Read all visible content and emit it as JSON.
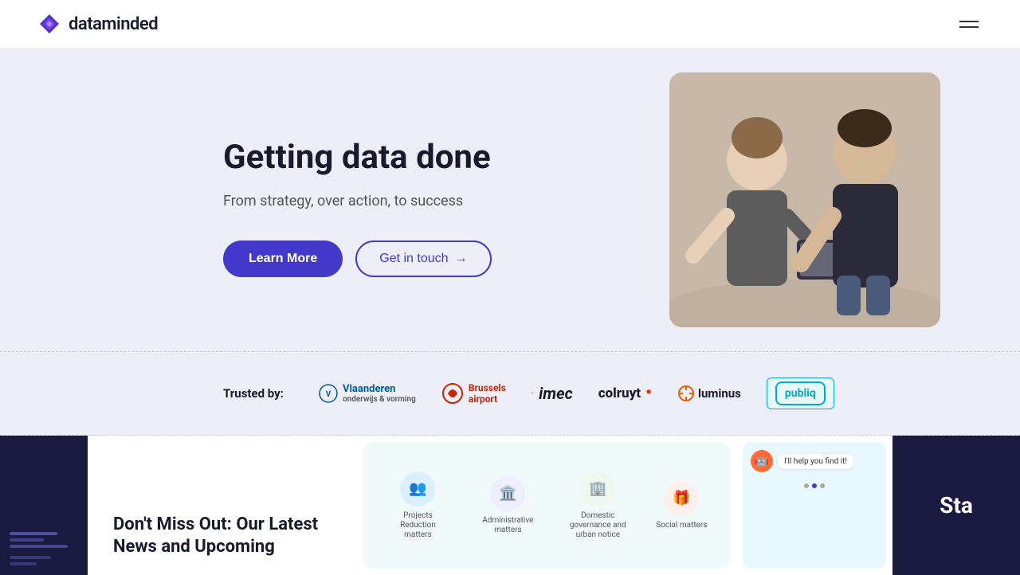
{
  "header": {
    "logo_text": "dataminded",
    "hamburger_label": "menu"
  },
  "hero": {
    "title": "Getting data done",
    "subtitle": "From strategy, over action, to success",
    "learn_more_label": "Learn More",
    "get_in_touch_label": "Get in touch"
  },
  "trusted": {
    "label": "Trusted by:",
    "logos": [
      {
        "name": "vlaanderen",
        "text": "Vlaanderen",
        "subtitle": "onderwijs & vorming"
      },
      {
        "name": "brussels-airport",
        "text": "Brussels airport"
      },
      {
        "name": "imec",
        "text": "imec"
      },
      {
        "name": "colruyt",
        "text": "colruyt"
      },
      {
        "name": "luminus",
        "text": "luminus"
      },
      {
        "name": "publiq",
        "text": "publiq"
      }
    ]
  },
  "news": {
    "title": "Don't Miss Out: Our Latest News and Upcoming",
    "icons": [
      {
        "label": "Projects Reduction matters",
        "emoji": "👥"
      },
      {
        "label": "Administrative matters",
        "emoji": "🏛️"
      },
      {
        "label": "Domestic governance and urban notice",
        "emoji": "🏢"
      },
      {
        "label": "Social matters",
        "emoji": "🎁"
      }
    ],
    "chat_bubble": "I'll help you find it!",
    "start_text": "Sta"
  }
}
